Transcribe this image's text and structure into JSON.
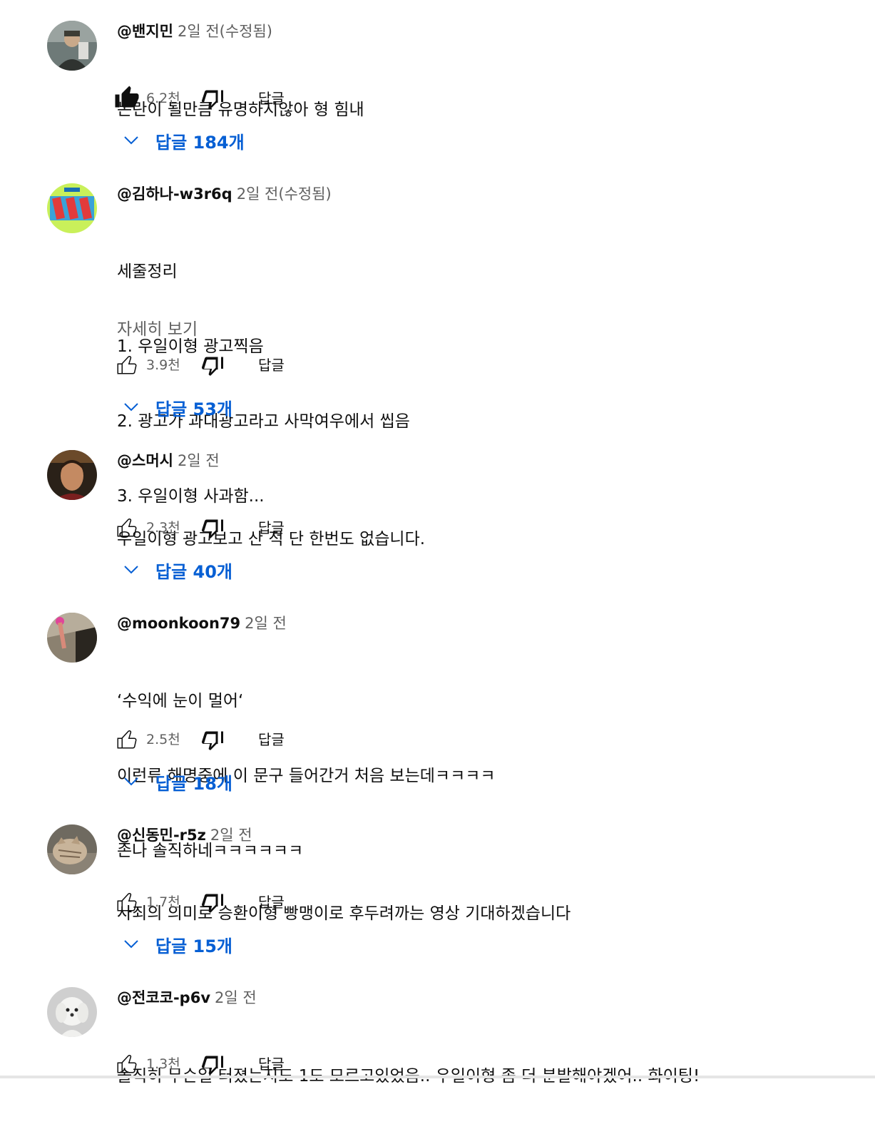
{
  "comments": [
    {
      "author": "@밴지민",
      "time": "2일 전(수정됨)",
      "lines": [
        "논란이 될만큼 유명하지않아 형 힘내"
      ],
      "likes": "6.2천",
      "liked": true,
      "reply_label": "답글",
      "replies_label": "답글 184개"
    },
    {
      "author": "@김하나-w3r6q",
      "time": "2일 전(수정됨)",
      "lines": [
        "세줄정리",
        "1. 우일이형 광고찍음",
        "2. 광고가 과대광고라고 사막여우에서 씹음",
        "3. 우일이형 사과함..."
      ],
      "read_more": "자세히 보기",
      "likes": "3.9천",
      "liked": false,
      "reply_label": "답글",
      "replies_label": "답글 53개"
    },
    {
      "author": "@스머시",
      "time": "2일 전",
      "lines": [
        "우일이형 광고보고 산 적 단 한번도 없습니다."
      ],
      "likes": "2.3천",
      "liked": false,
      "reply_label": "답글",
      "replies_label": "답글 40개"
    },
    {
      "author": "@moonkoon79",
      "time": "2일 전",
      "lines": [
        "‘수익에 눈이 멀어‘",
        "이런류 해명중에 이 문구 들어간거 처음 보는데ㅋㅋㅋㅋ",
        "존나 솔직하네ㅋㅋㅋㅋㅋㅋ"
      ],
      "likes": "2.5천",
      "liked": false,
      "reply_label": "답글",
      "replies_label": "답글 18개"
    },
    {
      "author": "@신동민-r5z",
      "time": "2일 전",
      "lines": [
        "사죄의 의미로 승환이형 빵맹이로 후두려까는 영상 기대하겠습니다"
      ],
      "likes": "1.7천",
      "liked": false,
      "reply_label": "답글",
      "replies_label": "답글 15개"
    },
    {
      "author": "@전코코-p6v",
      "time": "2일 전",
      "lines": [
        "솔직히 무슨일 터졌는지도 1도 모르고있었음.. 우일이형 좀 더 분발해야겠어.. 화이팅!"
      ],
      "likes": "1.3천",
      "liked": false,
      "reply_label": "답글"
    }
  ],
  "colors": {
    "link_blue": "#065fd4",
    "secondary_text": "#606060",
    "primary_text": "#0f0f0f"
  }
}
